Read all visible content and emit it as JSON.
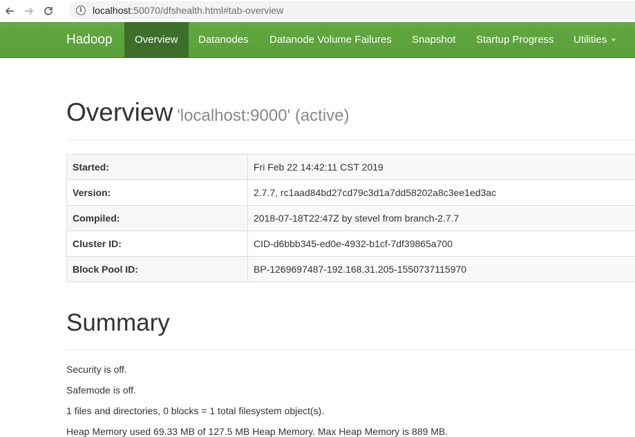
{
  "browser": {
    "back_icon": "arrow-left-icon",
    "forward_icon": "arrow-right-icon",
    "reload_icon": "reload-icon",
    "url_host": "localhost",
    "url_rest": ":50070/dfshealth.html#tab-overview"
  },
  "navbar": {
    "brand": "Hadoop",
    "items": [
      {
        "label": "Overview",
        "active": true
      },
      {
        "label": "Datanodes"
      },
      {
        "label": "Datanode Volume Failures"
      },
      {
        "label": "Snapshot"
      },
      {
        "label": "Startup Progress"
      },
      {
        "label": "Utilities"
      }
    ],
    "bg_color": "#5fa33e",
    "active_color": "#3d6e2a"
  },
  "overview": {
    "title": "Overview",
    "subtitle": "'localhost:9000' (active)",
    "rows": [
      {
        "key": "Started:",
        "value": "Fri Feb 22 14:42:11 CST 2019"
      },
      {
        "key": "Version:",
        "value": "2.7.7, rc1aad84bd27cd79c3d1a7dd58202a8c3ee1ed3ac"
      },
      {
        "key": "Compiled:",
        "value": "2018-07-18T22:47Z by stevel from branch-2.7.7"
      },
      {
        "key": "Cluster ID:",
        "value": "CID-d6bbb345-ed0e-4932-b1cf-7df39865a700"
      },
      {
        "key": "Block Pool ID:",
        "value": "BP-1269697487-192.168.31.205-1550737115970"
      }
    ]
  },
  "summary": {
    "title": "Summary",
    "lines": [
      "Security is off.",
      "Safemode is off.",
      "1 files and directories, 0 blocks = 1 total filesystem object(s).",
      "Heap Memory used 69.33 MB of 127.5 MB Heap Memory. Max Heap Memory is 889 MB."
    ]
  }
}
